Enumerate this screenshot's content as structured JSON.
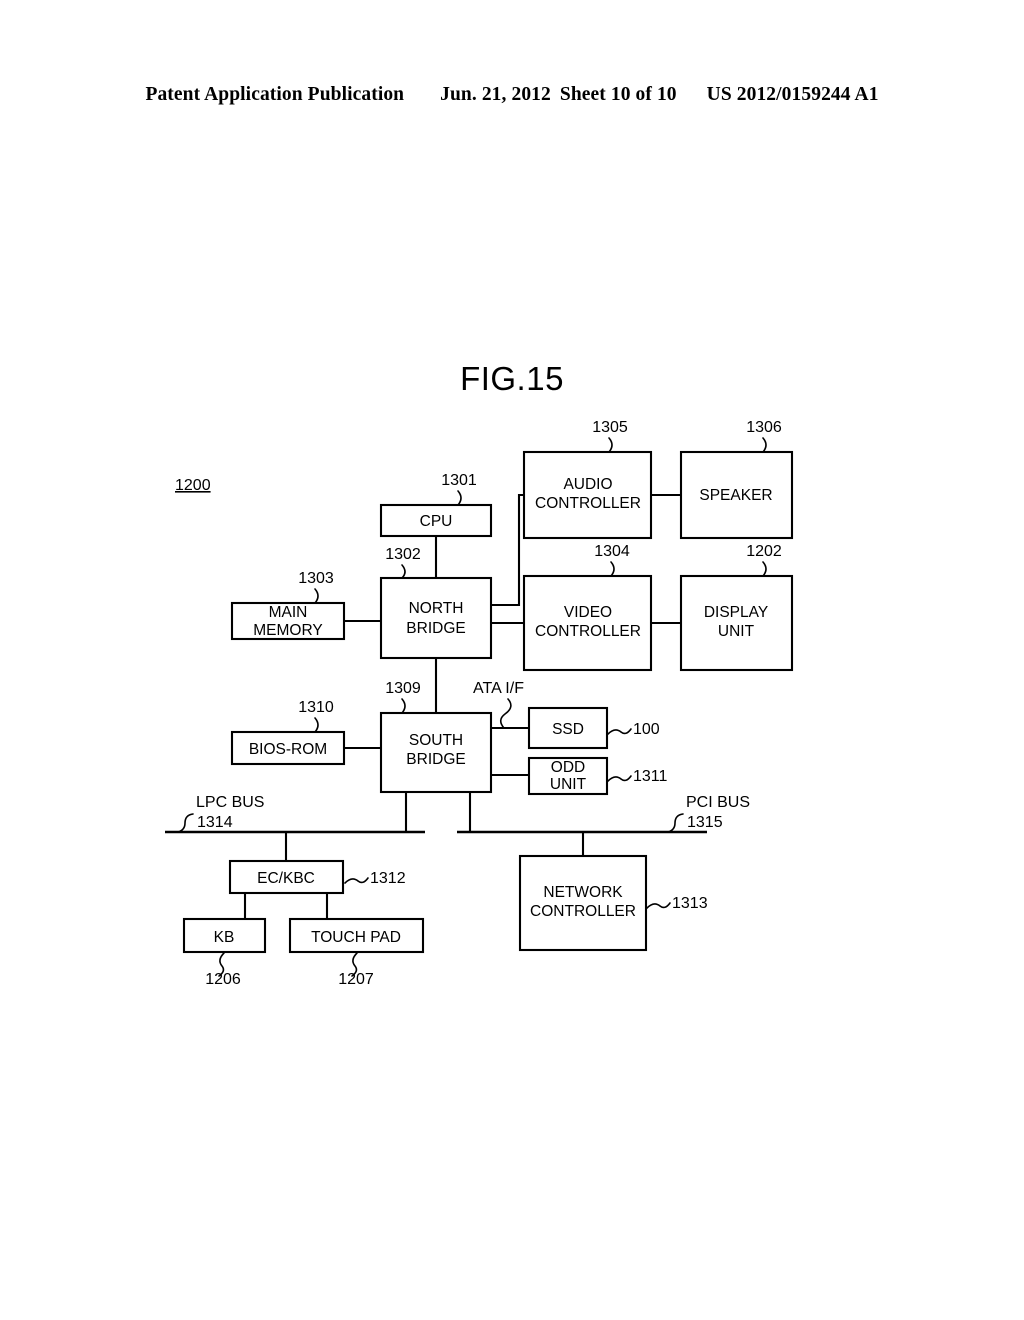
{
  "header": {
    "publication": "Patent Application Publication",
    "date": "Jun. 21, 2012",
    "sheet": "Sheet 10 of 10",
    "patent_number": "US 2012/0159244 A1"
  },
  "figure": {
    "title": "FIG.15",
    "system_ref": "1200"
  },
  "diagram": {
    "type": "block-diagram",
    "blocks": [
      {
        "id": "cpu",
        "label": "CPU",
        "ref": "1301"
      },
      {
        "id": "north-bridge",
        "label": "NORTH\nBRIDGE",
        "label_line1": "NORTH",
        "label_line2": "BRIDGE",
        "ref": "1302"
      },
      {
        "id": "main-memory",
        "label": "MAIN\nMEMORY",
        "label_line1": "MAIN",
        "label_line2": "MEMORY",
        "ref": "1303"
      },
      {
        "id": "audio-controller",
        "label": "AUDIO\nCONTROLLER",
        "label_line1": "AUDIO",
        "label_line2": "CONTROLLER",
        "ref": "1305"
      },
      {
        "id": "speaker",
        "label": "SPEAKER",
        "ref": "1306"
      },
      {
        "id": "video-controller",
        "label": "VIDEO\nCONTROLLER",
        "label_line1": "VIDEO",
        "label_line2": "CONTROLLER",
        "ref": "1304"
      },
      {
        "id": "display-unit",
        "label": "DISPLAY\nUNIT",
        "label_line1": "DISPLAY",
        "label_line2": "UNIT",
        "ref": "1202"
      },
      {
        "id": "south-bridge",
        "label": "SOUTH\nBRIDGE",
        "label_line1": "SOUTH",
        "label_line2": "BRIDGE",
        "ref": "1309"
      },
      {
        "id": "bios-rom",
        "label": "BIOS-ROM",
        "ref": "1310"
      },
      {
        "id": "ssd",
        "label": "SSD",
        "ref": "100"
      },
      {
        "id": "odd-unit",
        "label": "ODD\nUNIT",
        "label_line1": "ODD",
        "label_line2": "UNIT",
        "ref": "1311"
      },
      {
        "id": "ec-kbc",
        "label": "EC/KBC",
        "ref": "1312"
      },
      {
        "id": "kb",
        "label": "KB",
        "ref": "1206"
      },
      {
        "id": "touch-pad",
        "label": "TOUCH PAD",
        "ref": "1207"
      },
      {
        "id": "network-controller",
        "label": "NETWORK\nCONTROLLER",
        "label_line1": "NETWORK",
        "label_line2": "CONTROLLER",
        "ref": "1313"
      }
    ],
    "interfaces": [
      {
        "id": "ata-if",
        "label": "ATA I/F"
      }
    ],
    "buses": [
      {
        "id": "lpc-bus",
        "label": "LPC BUS",
        "ref": "1314"
      },
      {
        "id": "pci-bus",
        "label": "PCI BUS",
        "ref": "1315"
      }
    ],
    "connections": [
      {
        "from": "cpu",
        "to": "north-bridge"
      },
      {
        "from": "main-memory",
        "to": "north-bridge"
      },
      {
        "from": "north-bridge",
        "to": "audio-controller"
      },
      {
        "from": "audio-controller",
        "to": "speaker"
      },
      {
        "from": "north-bridge",
        "to": "video-controller"
      },
      {
        "from": "video-controller",
        "to": "display-unit"
      },
      {
        "from": "north-bridge",
        "to": "south-bridge"
      },
      {
        "from": "bios-rom",
        "to": "south-bridge"
      },
      {
        "from": "south-bridge",
        "to": "ssd",
        "via": "ata-if"
      },
      {
        "from": "south-bridge",
        "to": "odd-unit",
        "via": "ata-if"
      },
      {
        "from": "south-bridge",
        "to": "lpc-bus"
      },
      {
        "from": "south-bridge",
        "to": "pci-bus"
      },
      {
        "from": "lpc-bus",
        "to": "ec-kbc"
      },
      {
        "from": "ec-kbc",
        "to": "kb"
      },
      {
        "from": "ec-kbc",
        "to": "touch-pad"
      },
      {
        "from": "pci-bus",
        "to": "network-controller"
      }
    ]
  },
  "colors": {
    "ink": "#000000",
    "paper": "#ffffff"
  }
}
